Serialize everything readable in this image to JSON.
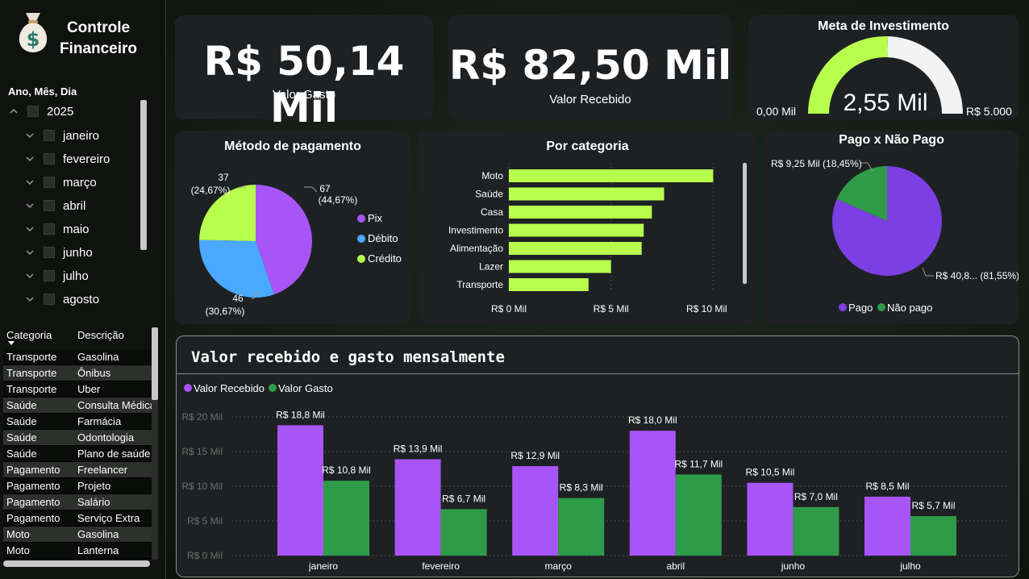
{
  "sidebar": {
    "title_line1": "Controle",
    "title_line2": "Financeiro",
    "date_slicer_title": "Ano, Mês, Dia",
    "year": "2025",
    "months": [
      "janeiro",
      "fevereiro",
      "março",
      "abril",
      "maio",
      "junho",
      "julho",
      "agosto"
    ],
    "table": {
      "headers": [
        "Categoria",
        "Descrição"
      ],
      "rows": [
        [
          "Transporte",
          "Gasolina"
        ],
        [
          "Transporte",
          "Ônibus"
        ],
        [
          "Transporte",
          "Uber"
        ],
        [
          "Saúde",
          "Consulta Médica"
        ],
        [
          "Saúde",
          "Farmácia"
        ],
        [
          "Saúde",
          "Odontologia"
        ],
        [
          "Saúde",
          "Plano de saúde"
        ],
        [
          "Pagamento",
          "Freelancer"
        ],
        [
          "Pagamento",
          "Projeto"
        ],
        [
          "Pagamento",
          "Salário"
        ],
        [
          "Pagamento",
          "Serviço Extra"
        ],
        [
          "Moto",
          "Gasolina"
        ],
        [
          "Moto",
          "Lanterna"
        ]
      ]
    }
  },
  "kpis": {
    "spent": {
      "value": "R$ 50,14 Mil",
      "label": "Valor Gasto"
    },
    "received": {
      "value": "R$ 82,50 Mil",
      "label": "Valor Recebido"
    }
  },
  "gauge": {
    "title": "Meta de Investimento",
    "value_text": "2,55 Mil",
    "min_label": "0,00 Mil",
    "max_label": "R$ 5.000",
    "value": 2550,
    "max": 5000,
    "fill_color": "#b8ff4d",
    "track_color": "#f2f2f2"
  },
  "payment_pie": {
    "title": "Método de pagamento",
    "slices": [
      {
        "name": "Pix",
        "count": "67",
        "pct": "(44,67%)",
        "value": 67,
        "color": "#a855f7"
      },
      {
        "name": "Débito",
        "count": "46",
        "pct": "(30,67%)",
        "value": 46,
        "color": "#4aa8ff"
      },
      {
        "name": "Crédito",
        "count": "37",
        "pct": "(24,67%)",
        "value": 37,
        "color": "#b8ff4d"
      }
    ]
  },
  "category_bar": {
    "title": "Por categoria",
    "categories": [
      "Moto",
      "Saúde",
      "Casa",
      "Investimento",
      "Alimentação",
      "Lazer",
      "Transporte"
    ],
    "values": [
      10.0,
      7.6,
      7.0,
      6.6,
      6.5,
      5.0,
      3.9
    ],
    "ticks": [
      "R$ 0 Mil",
      "R$ 5 Mil",
      "R$ 10 Mil"
    ],
    "max": 10.5,
    "color": "#b8ff4d"
  },
  "paid_pie": {
    "title": "Pago x Não Pago",
    "slices": [
      {
        "name": "Pago",
        "label": "R$ 40,8... (81,55%)",
        "value": 81.55,
        "color": "#7b3fe4"
      },
      {
        "name": "Não pago",
        "label": "R$ 9,25 Mil (18,45%)",
        "value": 18.45,
        "color": "#2e9b48"
      }
    ]
  },
  "monthly": {
    "title": "Valor recebido e gasto mensalmente",
    "legend": [
      "Valor Recebido",
      "Valor Gasto"
    ],
    "colors": [
      "#a855f7",
      "#2e9b48"
    ],
    "y_ticks": [
      "R$ 0 Mil",
      "R$ 5 Mil",
      "R$ 10 Mil",
      "R$ 15 Mil",
      "R$ 20 Mil"
    ],
    "y_tick_values": [
      0,
      5,
      10,
      15,
      20
    ],
    "months": [
      "janeiro",
      "fevereiro",
      "março",
      "abril",
      "junho",
      "julho"
    ],
    "received": [
      18.8,
      13.9,
      12.9,
      18.0,
      10.5,
      8.5
    ],
    "received_labels": [
      "R$ 18,8 Mil",
      "R$ 13,9 Mil",
      "R$ 12,9 Mil",
      "R$ 18,0 Mil",
      "R$ 10,5 Mil",
      "R$ 8,5 Mil"
    ],
    "spent": [
      10.8,
      6.7,
      8.3,
      11.7,
      7.0,
      5.7
    ],
    "spent_labels": [
      "R$ 10,8 Mil",
      "R$ 6,7 Mil",
      "R$ 8,3 Mil",
      "R$ 11,7 Mil",
      "R$ 7,0 Mil",
      "R$ 5,7 Mil"
    ]
  }
}
